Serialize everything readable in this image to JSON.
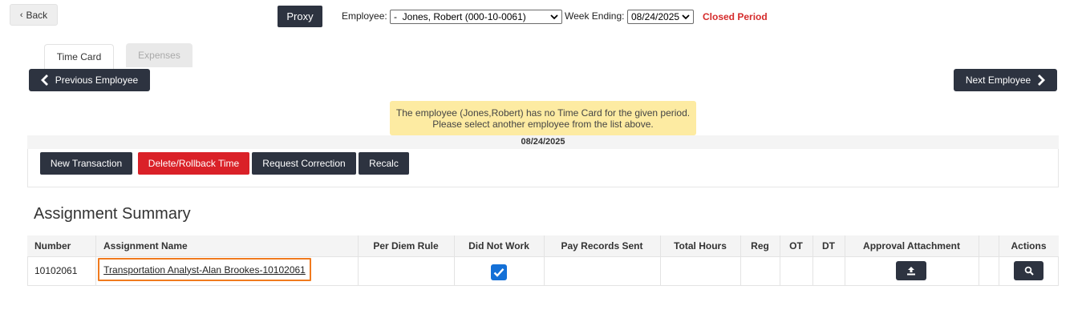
{
  "header": {
    "back_label": "Back",
    "back_icon": "chevron-left-icon",
    "proxy_label": "Proxy",
    "employee_label": "Employee:",
    "employee_value": "-  Jones, Robert (000-10-0061)",
    "week_ending_label": "Week Ending:",
    "week_ending_value": "08/24/2025",
    "period_status": "Closed Period"
  },
  "tabs": [
    {
      "label": "Time Card",
      "active": true
    },
    {
      "label": "Expenses",
      "active": false
    }
  ],
  "nav": {
    "prev_label": "Previous Employee",
    "next_label": "Next Employee"
  },
  "notice": {
    "line1": "The employee (Jones,Robert) has no Time Card for the given period.",
    "line2": "Please select another employee from the list above."
  },
  "period_date": "08/24/2025",
  "actions": {
    "new_transaction": "New Transaction",
    "delete_rollback": "Delete/Rollback Time",
    "request_correction": "Request Correction",
    "recalc": "Recalc"
  },
  "summary": {
    "title": "Assignment Summary",
    "columns": [
      "Number",
      "Assignment Name",
      "Per Diem Rule",
      "Did Not Work",
      "Pay Records Sent",
      "Total Hours",
      "Reg",
      "OT",
      "DT",
      "Approval Attachment",
      "",
      "Actions"
    ],
    "rows": [
      {
        "number": "10102061",
        "assignment_name": "Transportation Analyst-Alan Brookes-10102061",
        "per_diem_rule": "",
        "did_not_work": true,
        "pay_records_sent": "",
        "total_hours": "",
        "reg": "",
        "ot": "",
        "dt": ""
      }
    ]
  },
  "colors": {
    "dark": "#2d3340",
    "danger": "#da2128",
    "closed_text": "#d52b2b",
    "notice_bg": "#fdeba2",
    "checkbox": "#1470d7",
    "highlight_border": "#f07a1e"
  }
}
